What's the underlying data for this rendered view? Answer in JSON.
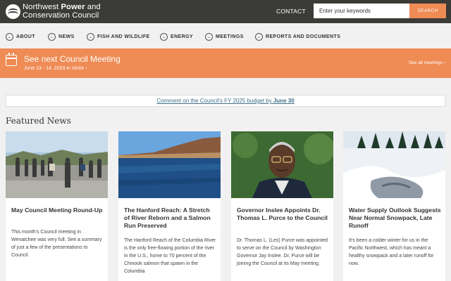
{
  "header": {
    "logo_line1_prefix": "Northwest ",
    "logo_line1_bold": "Power",
    "logo_line1_suffix": " and",
    "logo_line2": "Conservation Council",
    "contact_label": "CONTACT",
    "search_placeholder": "Enter your keywords",
    "search_button": "SEARCH"
  },
  "nav": {
    "items": [
      {
        "label": "ABOUT"
      },
      {
        "label": "NEWS"
      },
      {
        "label": "FISH AND WILDLIFE"
      },
      {
        "label": "ENERGY"
      },
      {
        "label": "MEETINGS"
      },
      {
        "label": "REPORTS AND DOCUMENTS"
      }
    ]
  },
  "banner": {
    "title": "See next Council Meeting",
    "date": "June 13 - 14, 2023 in Victor ›",
    "see_all": "See all meetings ›",
    "icon": "calendar-icon"
  },
  "notice": {
    "prefix": "Comment on the Council's FY 2025 budget by ",
    "deadline": "June 30"
  },
  "featured": {
    "heading": "Featured News",
    "cards": [
      {
        "title": "May Council Meeting Round-Up",
        "body": "This month's Council meeting in Wenatchee was very full. See a summary of just a few of the presentations to Council."
      },
      {
        "title": "The Hanford Reach: A Stretch of River Reborn and a Salmon Run Preserved",
        "body": "The Hanford Reach of the Columbia River is the only free-flowing portion of the river in the U.S., home to 70 percent of the Chinook salmon that spawn in the Columbia"
      },
      {
        "title": "Governor Inslee Appoints Dr. Thomas L. Purce to the Council",
        "body": "Dr. Thomas L. (Les) Purce was appointed to serve on the Council by Washington Governor Jay Inslee. Dr. Purce will be joining the Council at its May meeting."
      },
      {
        "title": "Water Supply Outlook Suggests Near Normal Snowpack, Late Runoff",
        "body": "It's been a colder winter for us in the Pacific Northwest, which has meant a healthy snowpack and a later runoff for now."
      }
    ]
  },
  "colors": {
    "header_bg": "#3b3b38",
    "accent_orange": "#ef8b55",
    "link_blue": "#3f6f86"
  }
}
